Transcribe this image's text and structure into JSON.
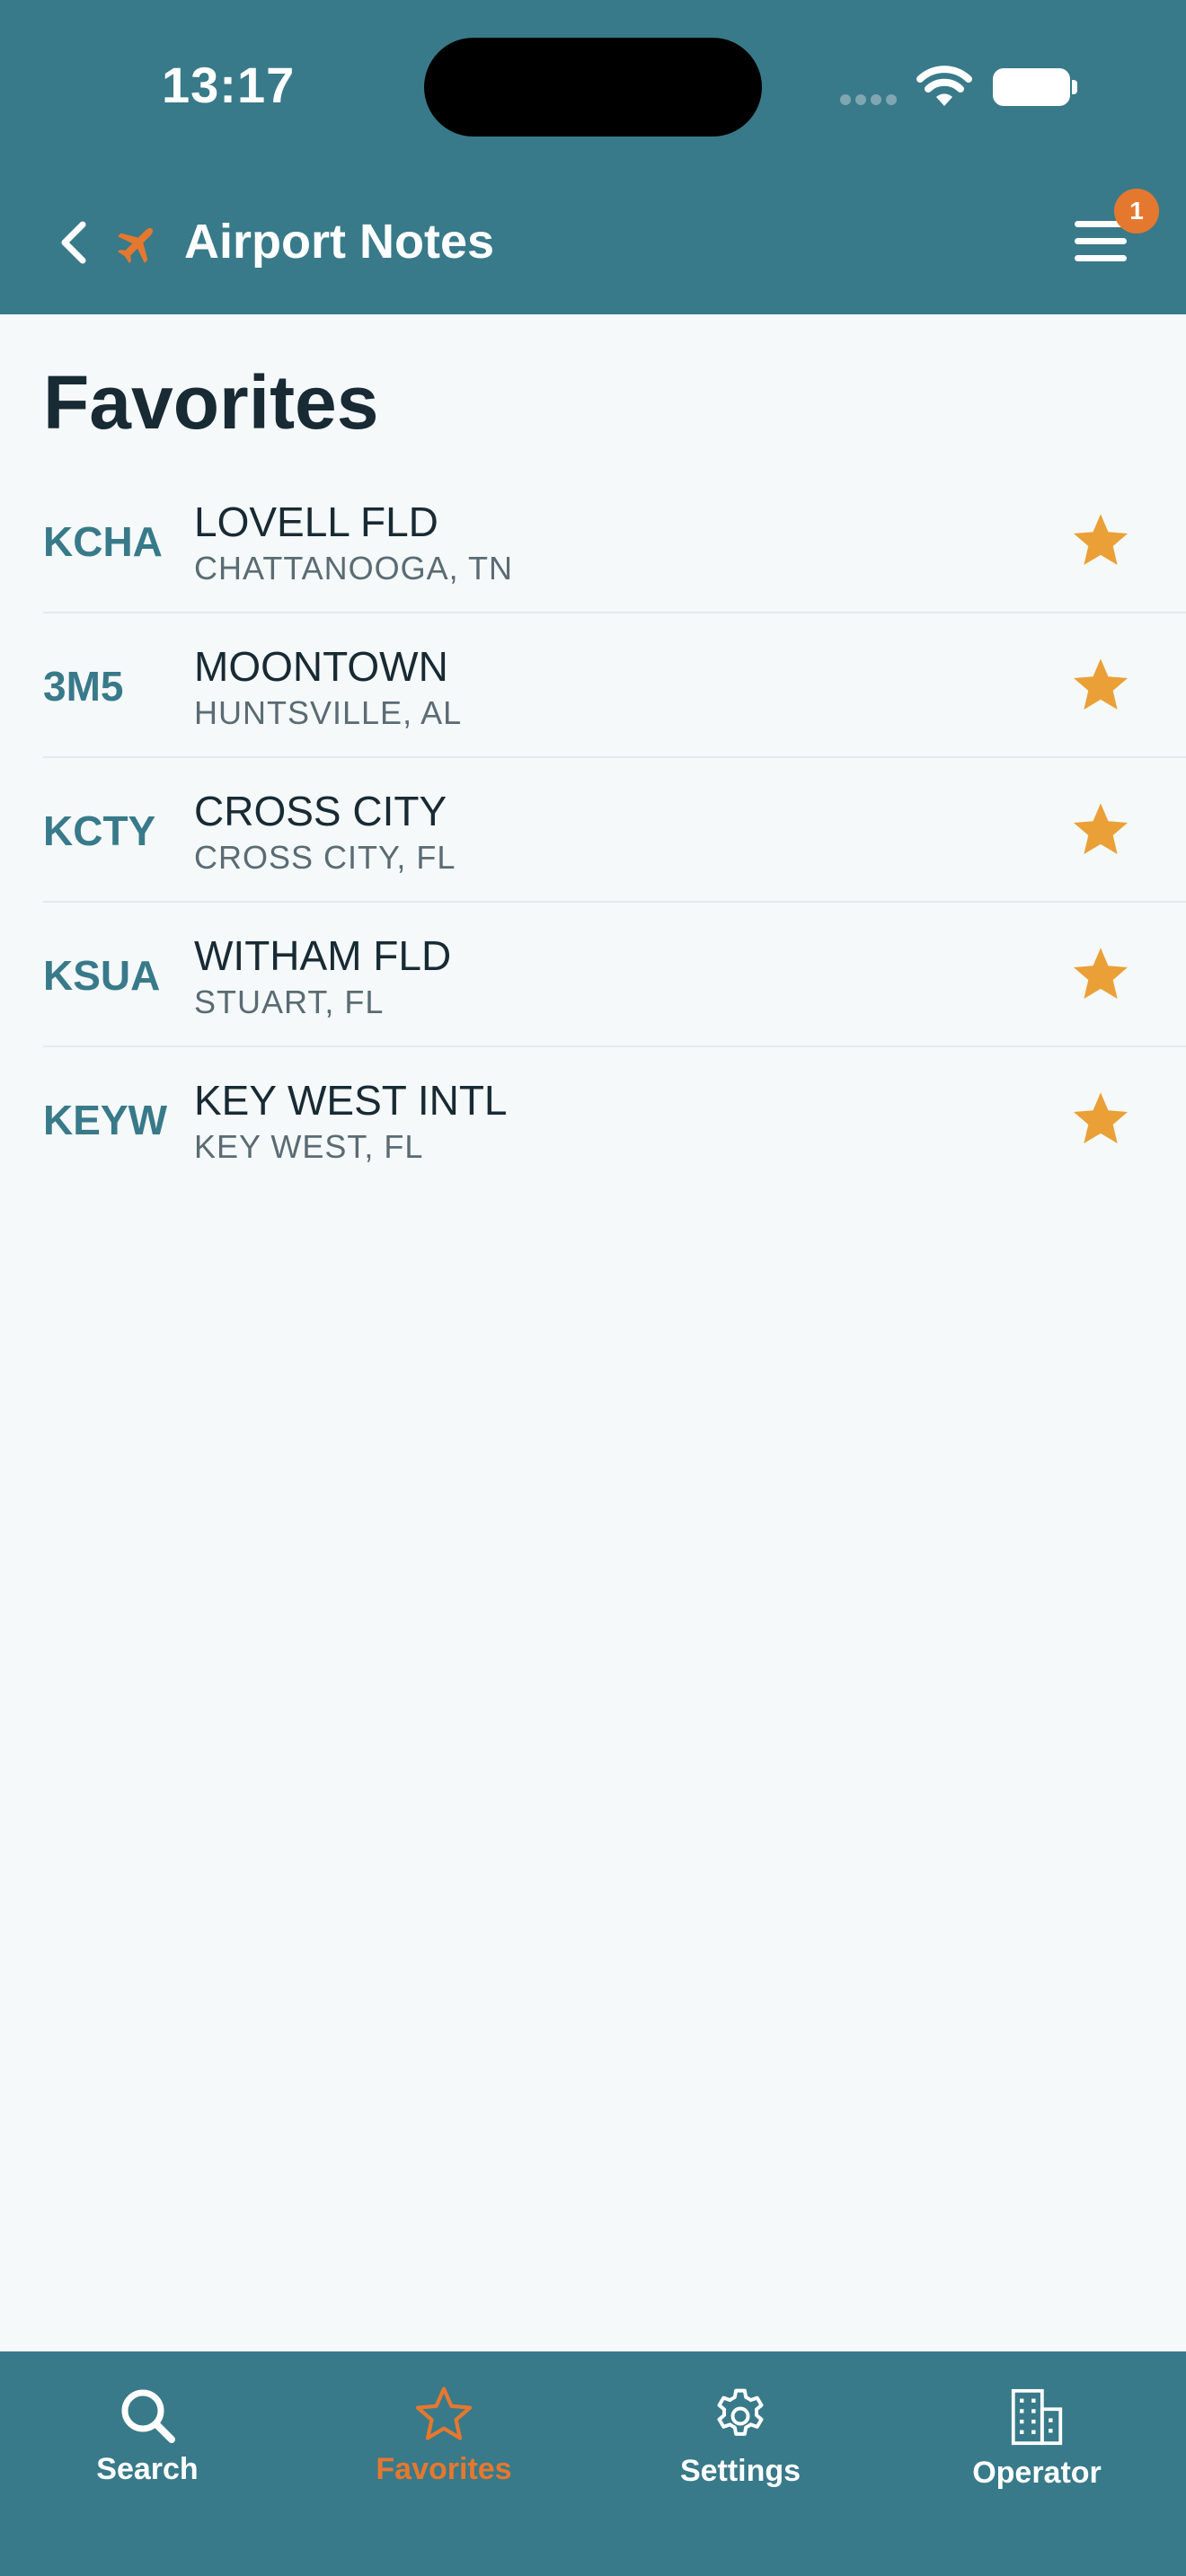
{
  "status_bar": {
    "time": "13:17"
  },
  "nav": {
    "title": "Airport Notes",
    "notification_count": "1"
  },
  "page": {
    "title": "Favorites"
  },
  "favorites": [
    {
      "code": "KCHA",
      "name": "LOVELL FLD",
      "city": "CHATTANOOGA, TN"
    },
    {
      "code": "3M5",
      "name": "MOONTOWN",
      "city": "HUNTSVILLE, AL"
    },
    {
      "code": "KCTY",
      "name": "CROSS CITY",
      "city": "CROSS CITY, FL"
    },
    {
      "code": "KSUA",
      "name": "WITHAM FLD",
      "city": "STUART, FL"
    },
    {
      "code": "KEYW",
      "name": "KEY WEST INTL",
      "city": "KEY WEST, FL"
    }
  ],
  "tabs": [
    {
      "label": "Search",
      "icon": "search-icon",
      "active": false
    },
    {
      "label": "Favorites",
      "icon": "star-icon",
      "active": true
    },
    {
      "label": "Settings",
      "icon": "gear-icon",
      "active": false
    },
    {
      "label": "Operator",
      "icon": "building-icon",
      "active": false
    }
  ],
  "colors": {
    "primary": "#387a89",
    "accent": "#e5782f",
    "star": "#eaa037",
    "background": "#f5f9fa"
  }
}
